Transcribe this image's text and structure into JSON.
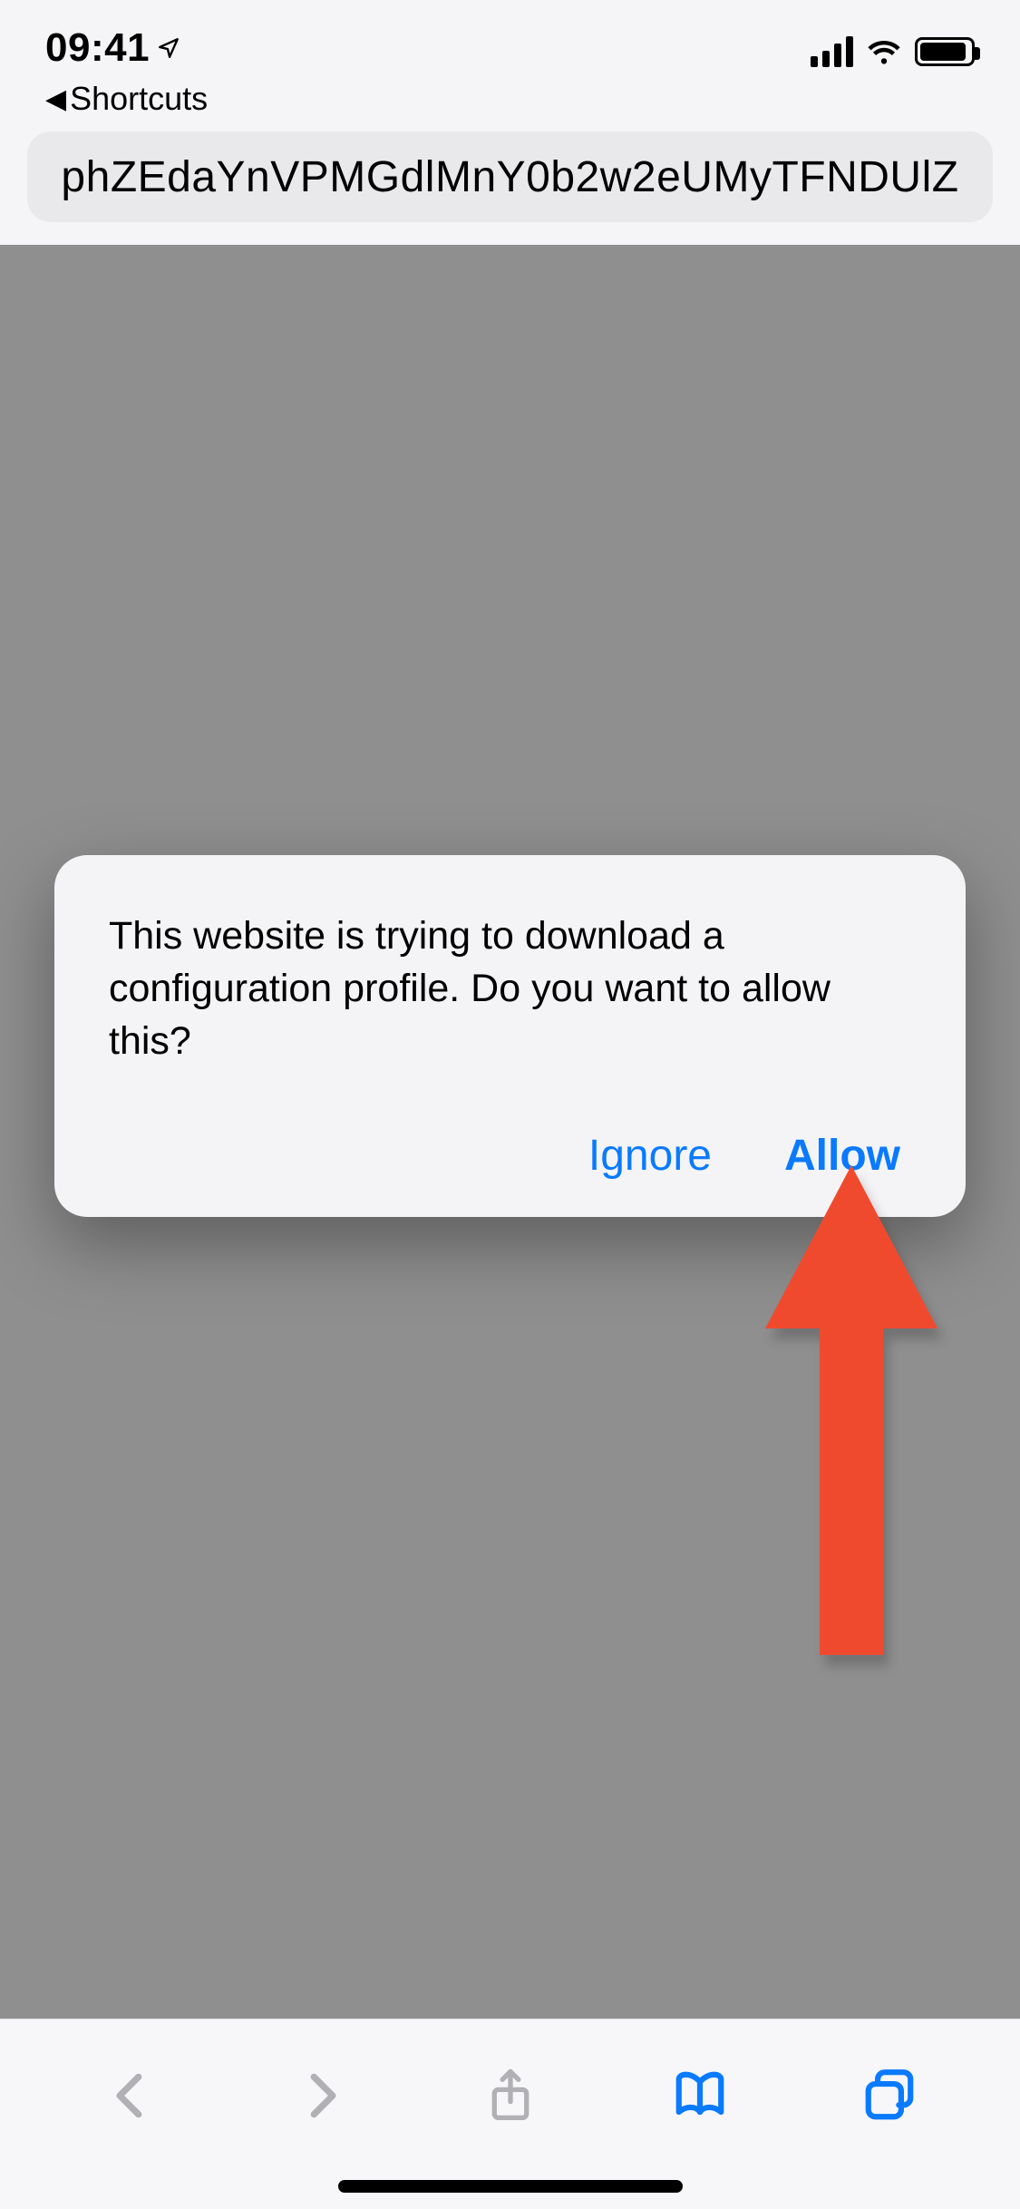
{
  "status": {
    "time": "09:41",
    "back_app": "Shortcuts"
  },
  "url_bar": {
    "text": "phZEdaYnVPMGdlMnY0b2w2eUMyTFNDUlZ"
  },
  "modal": {
    "message": "This website is trying to download a configuration profile. Do you want to allow this?",
    "ignore_label": "Ignore",
    "allow_label": "Allow"
  },
  "annotation": {
    "target": "allow-button",
    "color": "#f04a2e"
  }
}
